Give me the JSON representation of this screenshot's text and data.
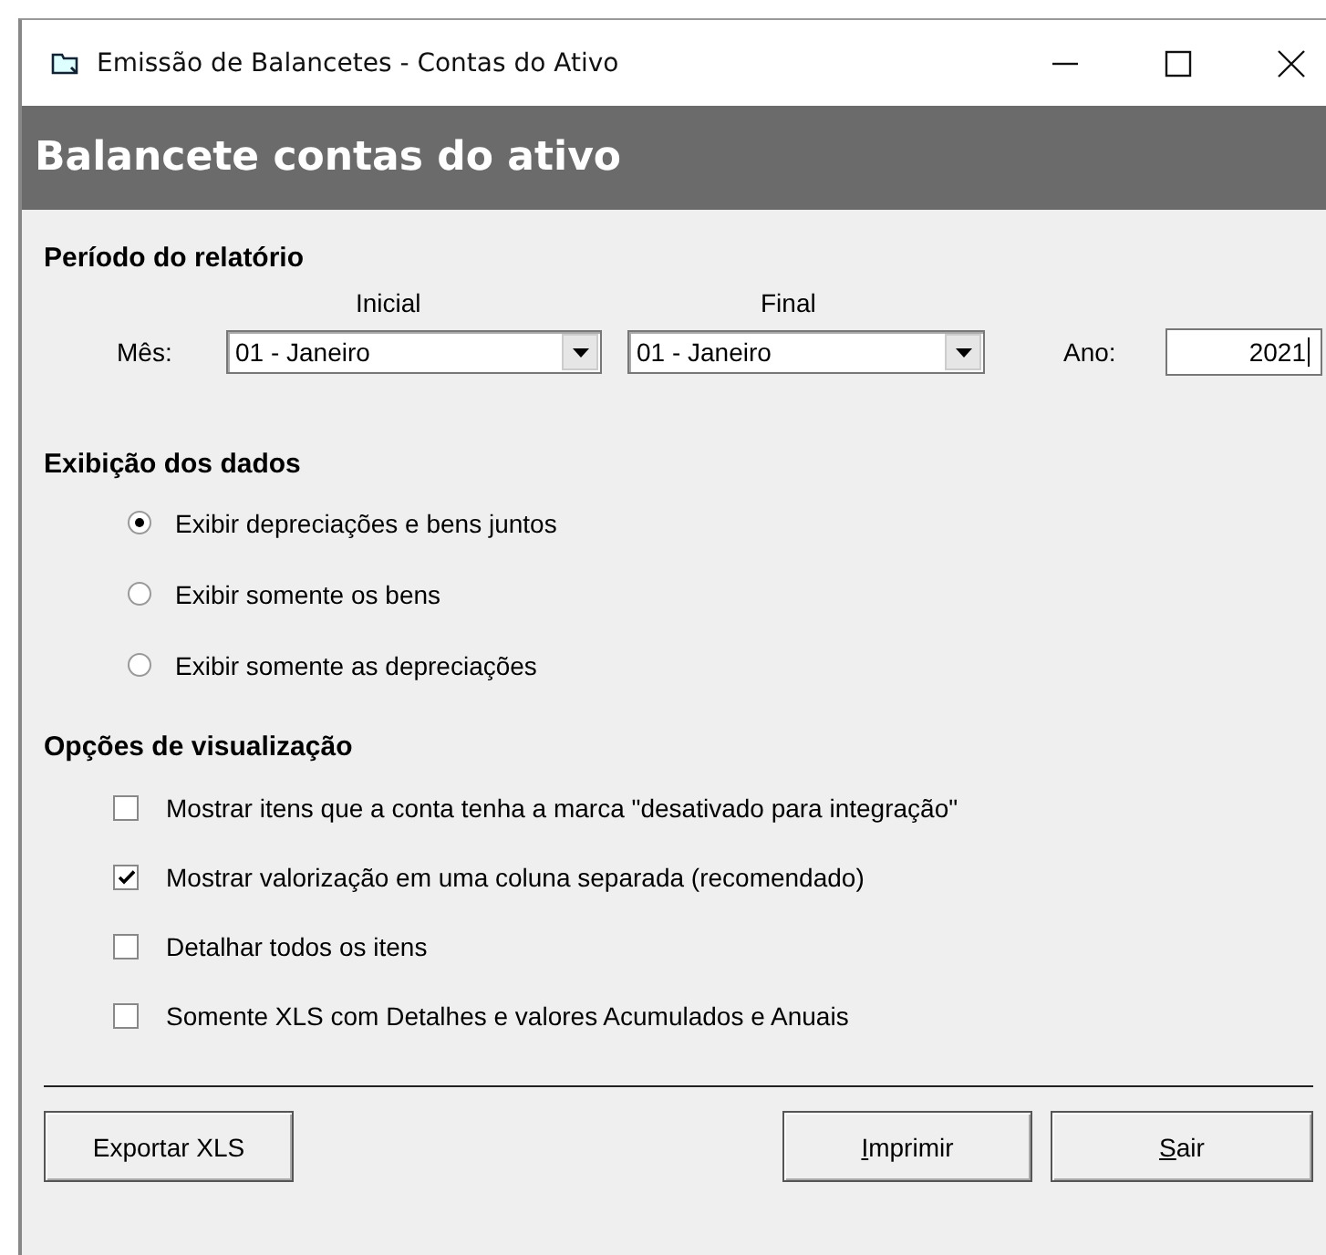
{
  "window": {
    "title": "Emissão de Balancetes - Contas do Ativo"
  },
  "header": "Balancete contas do ativo",
  "period": {
    "title": "Período do relatório",
    "start_label": "Inicial",
    "end_label": "Final",
    "month_label": "Mês:",
    "start_month": "01 - Janeiro",
    "end_month": "01 - Janeiro",
    "year_label": "Ano:",
    "year": "2021"
  },
  "display": {
    "title": "Exibição dos dados",
    "options": [
      {
        "label": "Exibir depreciações e bens juntos",
        "selected": true
      },
      {
        "label": "Exibir somente os bens",
        "selected": false
      },
      {
        "label": "Exibir somente as depreciações",
        "selected": false
      }
    ]
  },
  "view_options": {
    "title": "Opções de visualização",
    "items": [
      {
        "label": "Mostrar itens que a conta tenha a marca \"desativado para integração\"",
        "checked": false
      },
      {
        "label": "Mostrar valorização em uma coluna separada (recomendado)",
        "checked": true
      },
      {
        "label": "Detalhar todos os itens",
        "checked": false
      },
      {
        "label": "Somente XLS com Detalhes e valores Acumulados e Anuais",
        "checked": false
      }
    ]
  },
  "buttons": [
    {
      "kind": "plain",
      "label": "Exportar XLS"
    },
    {
      "kind": "spacer"
    },
    {
      "kind": "accel",
      "accel": "I",
      "label": "mprimir"
    },
    {
      "kind": "accel",
      "accel": "S",
      "label": "air"
    }
  ]
}
